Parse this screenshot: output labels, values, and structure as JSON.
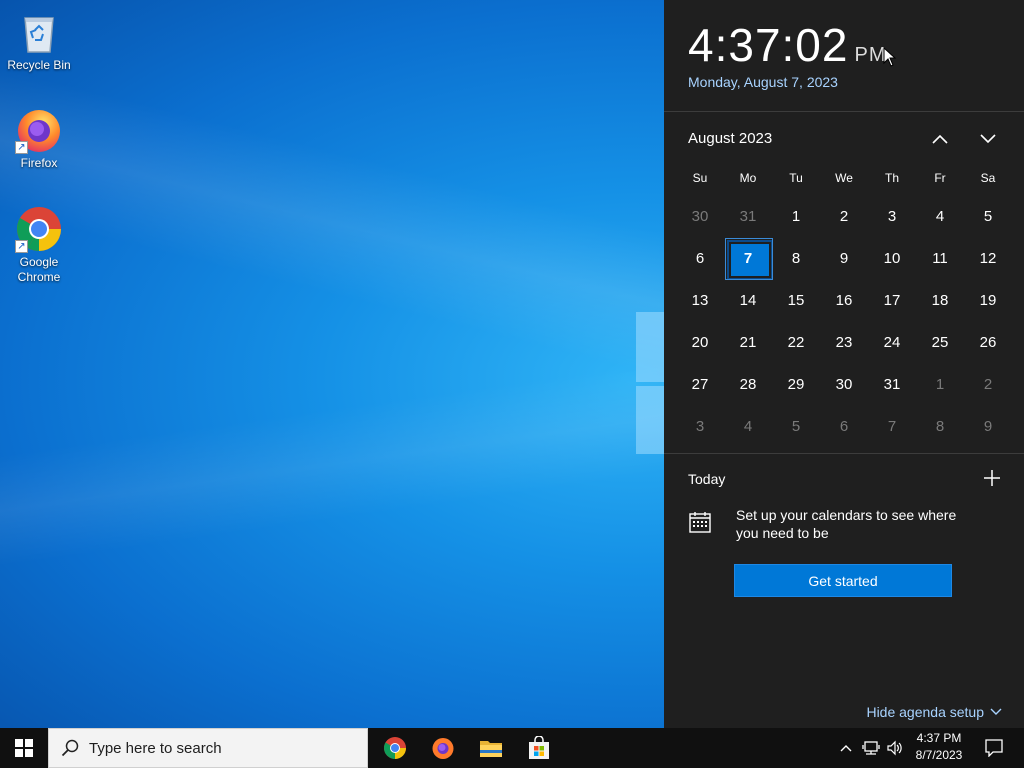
{
  "desktop": {
    "icons": [
      {
        "label": "Recycle Bin"
      },
      {
        "label": "Firefox"
      },
      {
        "label": "Google Chrome"
      }
    ]
  },
  "flyout": {
    "time": "4:37:02",
    "ampm": "PM",
    "long_date": "Monday, August 7, 2023",
    "month_label": "August 2023",
    "weekdays": [
      "Su",
      "Mo",
      "Tu",
      "We",
      "Th",
      "Fr",
      "Sa"
    ],
    "days": [
      {
        "d": "30",
        "dim": true
      },
      {
        "d": "31",
        "dim": true
      },
      {
        "d": "1"
      },
      {
        "d": "2"
      },
      {
        "d": "3"
      },
      {
        "d": "4"
      },
      {
        "d": "5"
      },
      {
        "d": "6"
      },
      {
        "d": "7",
        "today": true
      },
      {
        "d": "8"
      },
      {
        "d": "9"
      },
      {
        "d": "10"
      },
      {
        "d": "11"
      },
      {
        "d": "12"
      },
      {
        "d": "13"
      },
      {
        "d": "14"
      },
      {
        "d": "15"
      },
      {
        "d": "16"
      },
      {
        "d": "17"
      },
      {
        "d": "18"
      },
      {
        "d": "19"
      },
      {
        "d": "20"
      },
      {
        "d": "21"
      },
      {
        "d": "22"
      },
      {
        "d": "23"
      },
      {
        "d": "24"
      },
      {
        "d": "25"
      },
      {
        "d": "26"
      },
      {
        "d": "27"
      },
      {
        "d": "28"
      },
      {
        "d": "29"
      },
      {
        "d": "30"
      },
      {
        "d": "31"
      },
      {
        "d": "1",
        "dim": true
      },
      {
        "d": "2",
        "dim": true
      },
      {
        "d": "3",
        "dim": true
      },
      {
        "d": "4",
        "dim": true
      },
      {
        "d": "5",
        "dim": true
      },
      {
        "d": "6",
        "dim": true
      },
      {
        "d": "7",
        "dim": true
      },
      {
        "d": "8",
        "dim": true
      },
      {
        "d": "9",
        "dim": true
      }
    ],
    "today_label": "Today",
    "agenda_message": "Set up your calendars to see where you need to be",
    "get_started_label": "Get started",
    "hide_agenda_label": "Hide agenda setup"
  },
  "taskbar": {
    "search_placeholder": "Type here to search",
    "clock_time": "4:37 PM",
    "clock_date": "8/7/2023",
    "pinned_apps": [
      "chrome-icon",
      "firefox-icon",
      "file-explorer-icon",
      "microsoft-store-icon"
    ]
  },
  "colors": {
    "accent": "#0078d7",
    "flyout_bg": "#1f1f1f",
    "link": "#a8d3ff",
    "taskbar_bg": "#101010"
  }
}
